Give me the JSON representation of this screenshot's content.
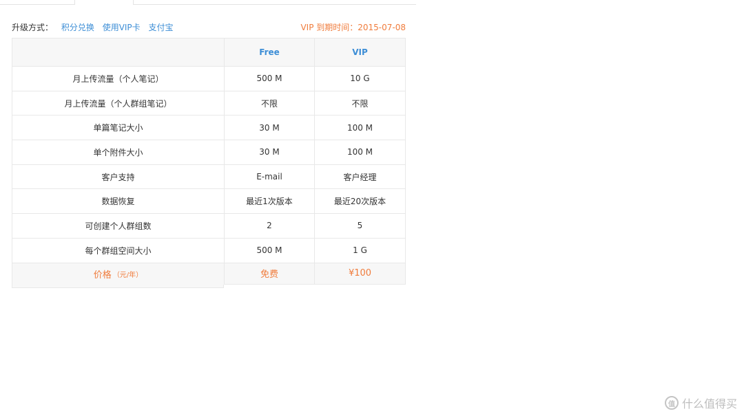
{
  "upgrade": {
    "label": "升级方式：",
    "links": [
      "积分兑换",
      "使用VIP卡",
      "支付宝"
    ],
    "vip_expiry": "VIP 到期时间：2015-07-08"
  },
  "table": {
    "headers": [
      "",
      "Free",
      "VIP"
    ],
    "rows": [
      [
        "月上传流量（个人笔记）",
        "500 M",
        "10 G"
      ],
      [
        "月上传流量（个人群组笔记）",
        "不限",
        "不限"
      ],
      [
        "单篇笔记大小",
        "30 M",
        "100 M"
      ],
      [
        "单个附件大小",
        "30 M",
        "100 M"
      ],
      [
        "客户支持",
        "E-mail",
        "客户经理"
      ],
      [
        "数据恢复",
        "最近1次版本",
        "最近20次版本"
      ],
      [
        "可创建个人群组数",
        "2",
        "5"
      ],
      [
        "每个群组空间大小",
        "500 M",
        "1 G"
      ]
    ],
    "price": {
      "label": "价格",
      "unit": "（元/年）",
      "free": "免费",
      "vip": "¥100"
    }
  },
  "watermark": {
    "logo": "值",
    "text": "什么值得买"
  },
  "colors": {
    "link": "#3d8ed6",
    "accent": "#f07c3c",
    "border": "#e8e8e8",
    "header_bg": "#f7f7f7"
  }
}
